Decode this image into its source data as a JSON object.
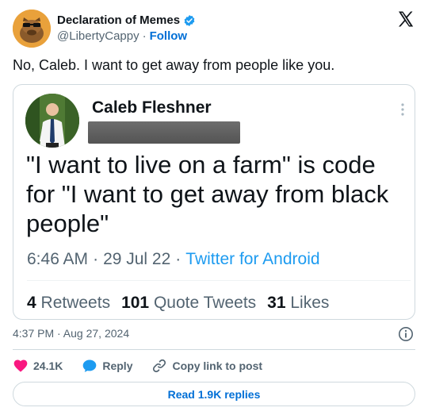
{
  "author": {
    "display_name": "Declaration of Memes",
    "handle": "@LibertyCappy",
    "separator": "·",
    "follow_label": "Follow"
  },
  "tweet": {
    "text": "No, Caleb. I want to get away from people like you.",
    "timestamp": "4:37 PM · Aug 27, 2024"
  },
  "quoted": {
    "name": "Caleb Fleshner",
    "body": "\"I want to live on a farm\" is code for \"I want to get away from black people\"",
    "time": "6:46 AM",
    "date": "29 Jul 22",
    "dot": "·",
    "source": "Twitter for Android",
    "retweets_count": "4",
    "retweets_label": "Retweets",
    "quotes_count": "101",
    "quotes_label": "Quote Tweets",
    "likes_count": "31",
    "likes_label": "Likes"
  },
  "actions": {
    "likes": "24.1K",
    "reply": "Reply",
    "copy_link": "Copy link to post"
  },
  "footer": {
    "read_replies": "Read 1.9K replies"
  },
  "colors": {
    "accent": "#1d9bf0",
    "link": "#006fd6",
    "heart": "#f91880",
    "reply_bubble": "#1d9bf0"
  },
  "icons": [
    "verified-badge-icon",
    "x-logo-icon",
    "more-dots-icon",
    "info-icon",
    "heart-icon",
    "reply-bubble-icon",
    "link-icon"
  ]
}
